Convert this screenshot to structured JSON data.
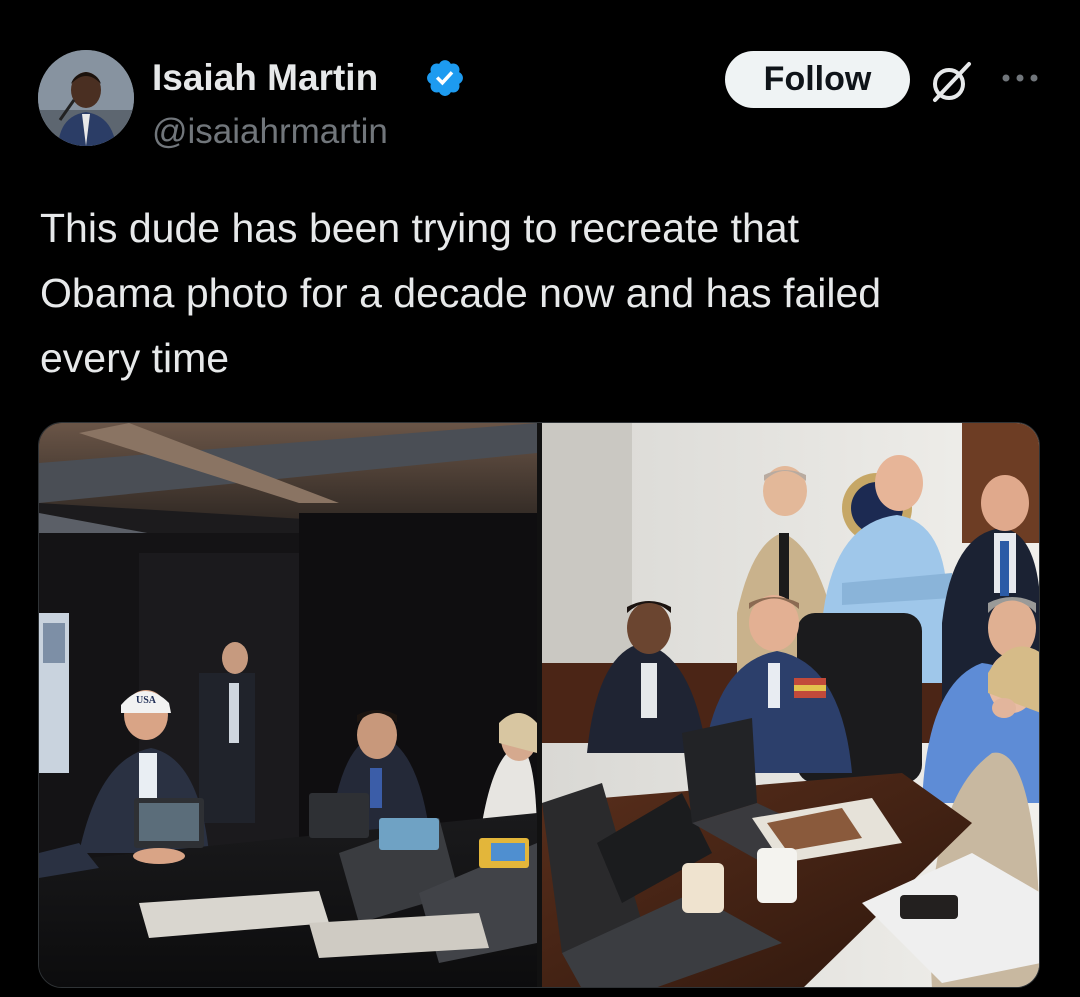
{
  "tweet": {
    "author": {
      "display_name": "Isaiah Martin",
      "handle": "@isaiahrmartin",
      "verified": true,
      "avatar_icon": "user-avatar"
    },
    "actions": {
      "follow_label": "Follow",
      "grok_icon": "grok-icon",
      "more_icon": "more-options-icon"
    },
    "text_lines": [
      "This dude has been trying to recreate that",
      "Obama photo for a decade now and has failed",
      "every time"
    ],
    "media": [
      {
        "kind": "photo",
        "badge_text": "USA"
      },
      {
        "kind": "photo"
      }
    ]
  },
  "colors": {
    "background": "#000000",
    "primary_text": "#e7e9ea",
    "secondary_text": "#71767b",
    "verified_blue": "#1d9bf0",
    "follow_bg": "#eff3f4"
  }
}
